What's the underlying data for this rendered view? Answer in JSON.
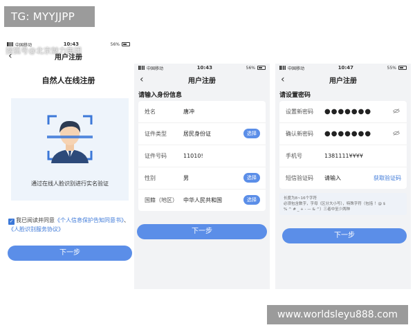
{
  "watermark_tag": "TG: MYYJJPP",
  "url_watermark": "www.worldsleyu888.com",
  "screen1": {
    "carrier": "中国移动",
    "time": "10:43",
    "battery": "56%",
    "source_watermark": "搜狐号@北京魅力集团",
    "title": "用户注册",
    "heading": "自然人在线注册",
    "face_caption": "通过在线人脸识别进行实名验证",
    "agreement_prefix": "我已阅读并同意",
    "agreement_link1": "《个人信息保护告知同意书》",
    "agreement_sep": "、",
    "agreement_link2": "《人脸识别服务协议》",
    "next_button": "下一步"
  },
  "screen2": {
    "carrier": "中国移动",
    "time": "10:43",
    "battery": "56%",
    "title": "用户注册",
    "section": "请输入身份信息",
    "rows": [
      {
        "label": "姓名",
        "value": "唐冲",
        "button": ""
      },
      {
        "label": "证件类型",
        "value": "居民身份证",
        "button": "选择"
      },
      {
        "label": "证件号码",
        "value": "11010!",
        "button": ""
      },
      {
        "label": "性别",
        "value": "男",
        "button": "选择"
      },
      {
        "label": "国籍（地区）",
        "value": "中华人民共和国",
        "button": "选择"
      }
    ],
    "next_button": "下一步"
  },
  "screen3": {
    "carrier": "中国移动",
    "time": "10:47",
    "battery": "55%",
    "title": "用户注册",
    "section": "请设置密码",
    "new_password_label": "设置新密码",
    "new_password_value": "●●●●●●●",
    "confirm_password_label": "确认新密码",
    "confirm_password_value": "●●●●●●●",
    "phone_label": "手机号",
    "phone_value": "1381111¥¥¥¥",
    "sms_label": "短信验证码",
    "sms_placeholder": "请输入",
    "get_code": "获取验证码",
    "hint_line1": "长度为8~16个字符",
    "hint_line2": "必须包含数字，字母（区分大小写），特殊字符（包括 ！@ $",
    "hint_line3": "% ^ # _ + - — & ^）三者中至少两种",
    "next_button": "下一步"
  }
}
